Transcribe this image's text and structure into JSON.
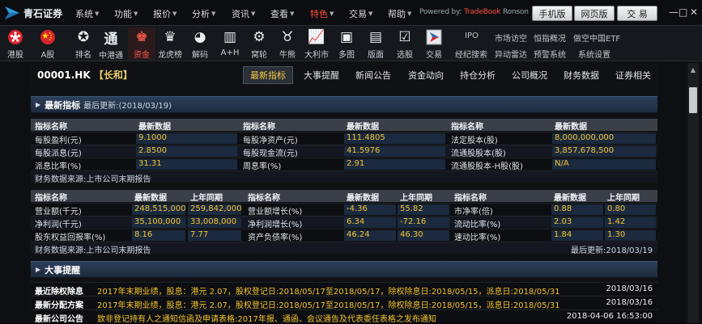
{
  "app": {
    "name": "青石证券"
  },
  "menu": [
    {
      "label": "系统"
    },
    {
      "label": "功能"
    },
    {
      "label": "报价"
    },
    {
      "label": "分析"
    },
    {
      "label": "资讯"
    },
    {
      "label": "查看"
    },
    {
      "label": "特色"
    },
    {
      "label": "交易"
    },
    {
      "label": "帮助"
    }
  ],
  "welcome": {
    "text": "Powered by:",
    "red": "TradeBook",
    "tail": "Ronson"
  },
  "top_buttons": {
    "mobile": "手机版",
    "web": "网页版",
    "trade": "交 易"
  },
  "window_controls": {
    "minimize": "—",
    "maximize": "□",
    "close": "✕"
  },
  "toolbar": [
    {
      "label": "港股",
      "icon": "hk-flag-icon"
    },
    {
      "label": "A股",
      "icon": "cn-flag-icon"
    },
    {
      "label": "排名",
      "icon": "medal-icon"
    },
    {
      "label": "中港通",
      "icon": "tong-icon"
    },
    {
      "label": "资金",
      "icon": "money-bag-icon"
    },
    {
      "label": "龙虎榜",
      "icon": "trophy-icon"
    },
    {
      "label": "解码",
      "icon": "chart-circle-icon"
    },
    {
      "label": "A+H",
      "icon": "bars-icon"
    },
    {
      "label": "窝轮",
      "icon": "gear-icon"
    },
    {
      "label": "牛熊",
      "icon": "bull-icon"
    },
    {
      "label": "大利市",
      "icon": "line-chart-icon"
    },
    {
      "label": "多图",
      "icon": "multi-chart-icon"
    },
    {
      "label": "版面",
      "icon": "layout-icon"
    },
    {
      "label": "选股",
      "icon": "select-stock-icon"
    },
    {
      "label": "交易",
      "icon": "trade-icon"
    }
  ],
  "right_grid": {
    "r1": [
      "IPO",
      "市场访空",
      "恒指概况",
      "做空中国ETF"
    ],
    "r2": [
      "经纪搜索",
      "异动雷达",
      "预警系统",
      "系统设置"
    ]
  },
  "stock": {
    "code": "00001.HK",
    "name_prefix": "【",
    "name": "长和",
    "name_suffix": "】"
  },
  "tabs": [
    {
      "label": "最新指标"
    },
    {
      "label": "大事提醒"
    },
    {
      "label": "新闻公告"
    },
    {
      "label": "资金动向"
    },
    {
      "label": "持仓分析"
    },
    {
      "label": "公司概况"
    },
    {
      "label": "财务数据"
    },
    {
      "label": "证券相关"
    }
  ],
  "latest": {
    "title": "最新指标",
    "updated": "最后更新:(2018/03/19)",
    "headers": [
      "指标名称",
      "最新数据",
      "指标名称",
      "最新数据",
      "指标名称",
      "最新数据"
    ],
    "rows": [
      [
        "每股盈利(元)",
        "9.1000",
        "每股净资产(元)",
        "111.4805",
        "法定股本(股)",
        "8,000,000,000"
      ],
      [
        "每股派息(元)",
        "2.8500",
        "每股现金流(元)",
        "41.5976",
        "流通股股本(股)",
        "3,857,678,500"
      ],
      [
        "派息比率(%)",
        "31.31",
        "周息率(%)",
        "2.91",
        "流通股股本-H股(股)",
        "N/A"
      ]
    ],
    "source": "财务数据来源:上市公司末期报告"
  },
  "growth": {
    "headers": [
      "指标名称",
      "最新数据",
      "上年同期",
      "指标名称",
      "最新数据",
      "上年同期",
      "指标名称",
      "最新数据",
      "上年同期"
    ],
    "rows": [
      [
        "营业额(千元)",
        "248,515,000",
        "259,842,000",
        "营业额增长(%)",
        "-4.36",
        "55.82",
        "市净率(倍)",
        "0.88",
        "0.80"
      ],
      [
        "净利润(千元)",
        "35,100,000",
        "33,008,000",
        "净利润增长(%)",
        "6.34",
        "-72.16",
        "流动比率(%)",
        "2.03",
        "1.42"
      ],
      [
        "股东权益回报率(%)",
        "8.16",
        "7.77",
        "资产负债率(%)",
        "46.24",
        "46.30",
        "速动比率(%)",
        "1.84",
        "1.30"
      ]
    ],
    "source": "财务数据来源:上市公司末期报告",
    "updated": "最后更新:2018/03/19"
  },
  "events": {
    "title": "大事提醒",
    "rows": [
      {
        "k": "最近除权除息",
        "v": "2017年末期业绩，股息：港元 2.07，股权登记日:2018/05/17至2018/05/17，除权除息日:2018/05/15，派息日:2018/05/31",
        "d": "2018/03/16"
      },
      {
        "k": "最新分配方案",
        "v": "2017年末期业绩，股息：港元 2.07，股权登记日:2018/05/17至2018/05/17，除权除息日:2018/05/15，派息日:2018/05/31",
        "d": "2018/03/16"
      },
      {
        "k": "最新公司公告",
        "v": "致非登记持有人之通知信函及申请表格:2017年报、通函、会议通告及代表委任表格之发布通知",
        "d": "2018-04-06 16:53:00"
      }
    ]
  },
  "colors": {
    "gold": "#f4c430",
    "red": "#ff5a4a",
    "green": "#3ccf4a",
    "header_blue": "#2c3f5a"
  }
}
